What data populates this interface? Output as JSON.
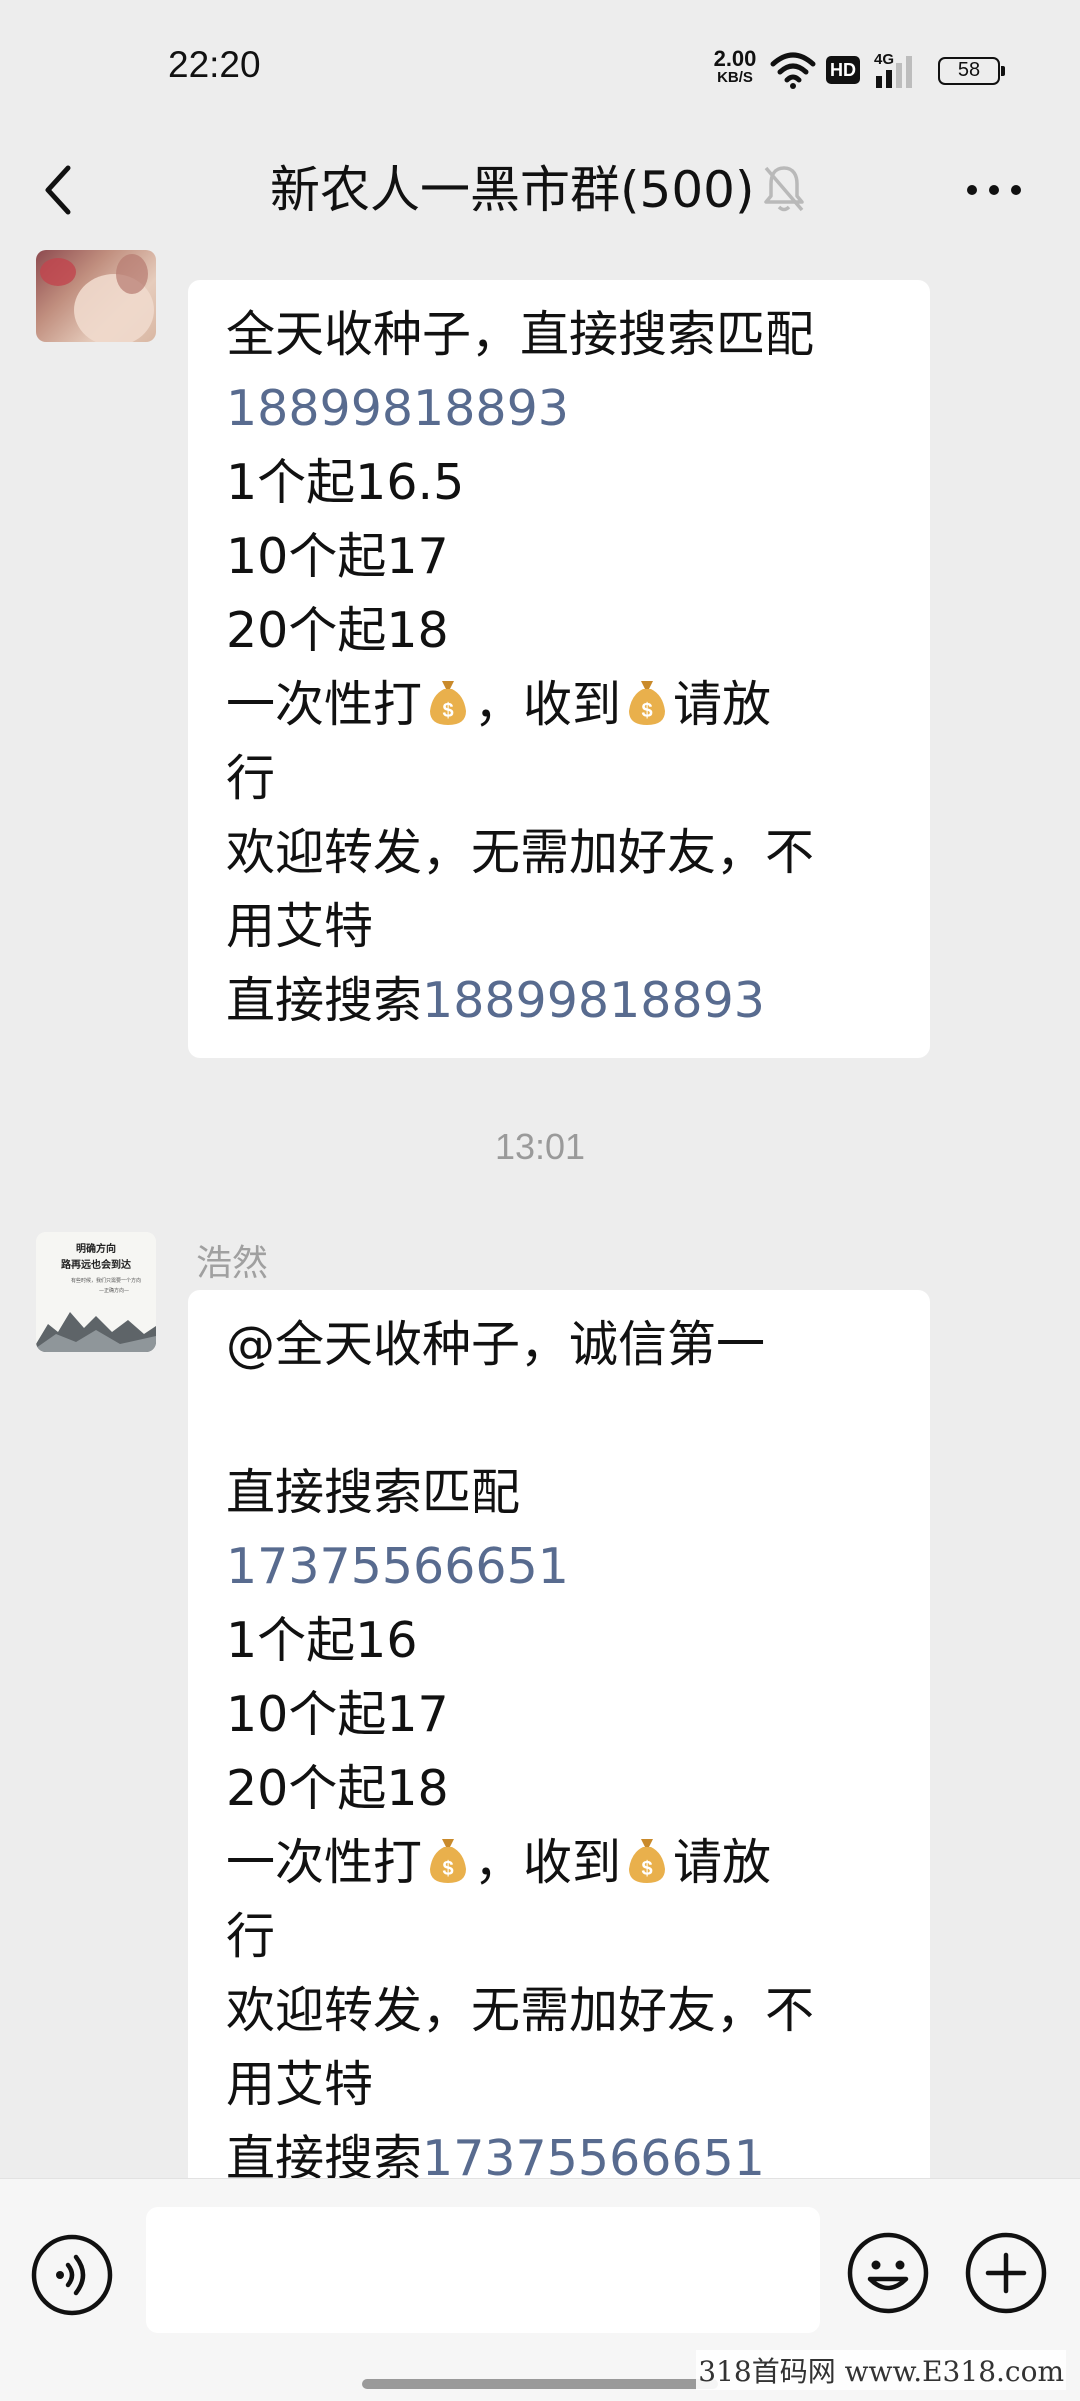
{
  "status_bar": {
    "time": "22:20",
    "net_speed_value": "2.00",
    "net_speed_unit": "KB/S",
    "hd_label": "HD",
    "network_type": "4G",
    "battery": "58"
  },
  "header": {
    "title": "新农人一黑市群(500)",
    "muted": true
  },
  "messages": [
    {
      "sender": "",
      "lines": [
        {
          "text": "全天收种子，直接搜索匹配"
        },
        {
          "phone": "18899818893"
        },
        {
          "text": "1个起16.5"
        },
        {
          "text": "10个起17"
        },
        {
          "text": "20个起18"
        },
        {
          "text_a": "一次性打",
          "emoji": "money-bag",
          "text_b": "，收到",
          "text_c": "请放"
        },
        {
          "text": "行"
        },
        {
          "text": "欢迎转发，无需加好友，不"
        },
        {
          "text": "用艾特"
        },
        {
          "text": "直接搜索",
          "phone": "18899818893"
        }
      ]
    },
    {
      "sender": "浩然",
      "avatar_text": [
        "明确方向",
        "路再远也会到达",
        "有些时候，我们只需要一个方向",
        "—正确方向—"
      ],
      "lines": [
        {
          "text": "@全天收种子，诚信第一"
        },
        {
          "text": ""
        },
        {
          "text": "直接搜索匹配"
        },
        {
          "phone": "17375566651"
        },
        {
          "text": "1个起16"
        },
        {
          "text": "10个起17"
        },
        {
          "text": "20个起18"
        },
        {
          "text_a": "一次性打",
          "emoji": "money-bag",
          "text_b": "，收到",
          "text_c": "请放"
        },
        {
          "text": "行"
        },
        {
          "text": "欢迎转发，无需加好友，不"
        },
        {
          "text": "用艾特"
        },
        {
          "text": "直接搜索",
          "phone": "17375566651"
        }
      ]
    }
  ],
  "timestamp": "13:01",
  "input_bar": {
    "placeholder": ""
  },
  "watermark": "318首码网 www.E318.com",
  "colors": {
    "background": "#ededed",
    "bubble": "#ffffff",
    "link": "#586b8f"
  }
}
